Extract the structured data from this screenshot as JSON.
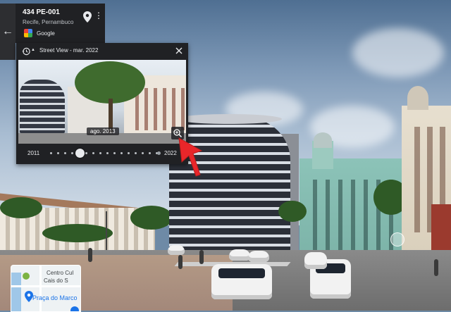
{
  "place_card": {
    "title": "434 PE-001",
    "subtitle": "Recife, Pernambuco",
    "brand": "Google"
  },
  "time_machine": {
    "title": "Street View - mar. 2022",
    "preview_date": "ago. 2013",
    "year_start": "2011",
    "year_end": "2022",
    "slider_position": 0.28,
    "timeline_dots": 16
  },
  "minimap": {
    "label_line1": "Centro Cul",
    "label_line2": "Cais do S",
    "label_line3": "Praça do Marco"
  },
  "colors": {
    "panel_bg": "#202124",
    "arrow": "#e8262a",
    "accent_blue": "#1a73e8"
  }
}
